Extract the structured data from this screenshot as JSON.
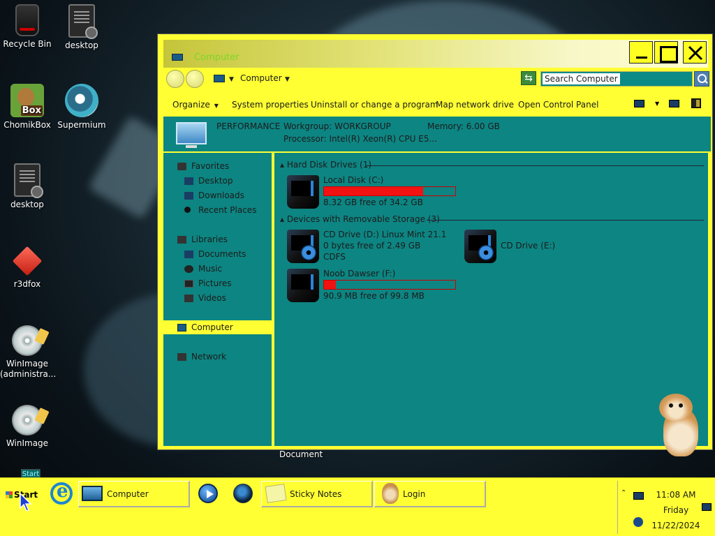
{
  "desktop": {
    "icons": [
      {
        "label": "Recycle Bin",
        "icon": "recycle-bin-icon"
      },
      {
        "label": "desktop",
        "icon": "document-icon"
      },
      {
        "label": "ChomikBox",
        "icon": "chomikbox-icon"
      },
      {
        "label": "Supermium",
        "icon": "supermium-icon"
      },
      {
        "label": "desktop",
        "icon": "document-icon"
      },
      {
        "label": "r3dfox",
        "icon": "r3dfox-icon"
      },
      {
        "label": "WinImage\n(administra...",
        "icon": "winimage-icon"
      },
      {
        "label": "WinImage",
        "icon": "winimage-icon"
      }
    ],
    "chomik_badge": "Box",
    "document_label": "Document",
    "start_tooltip": "Start"
  },
  "window": {
    "title": "Computer",
    "address": {
      "location": "Computer",
      "search_placeholder": "Search Computer"
    },
    "toolbar": {
      "organize": "Organize",
      "system_properties": "System properties",
      "uninstall": "Uninstall or change a program",
      "map_drive": "Map network drive",
      "control_panel": "Open Control Panel"
    },
    "details": {
      "name": "PERFORMANCE",
      "workgroup": "Workgroup: WORKGROUP",
      "memory": "Memory: 6.00 GB",
      "processor": "Processor: Intel(R) Xeon(R) CPU E5..."
    },
    "nav": {
      "favorites": "Favorites",
      "desktop": "Desktop",
      "downloads": "Downloads",
      "recent": "Recent Places",
      "libraries": "Libraries",
      "documents": "Documents",
      "music": "Music",
      "pictures": "Pictures",
      "videos": "Videos",
      "computer": "Computer",
      "network": "Network"
    },
    "groups": {
      "hdd": "Hard Disk Drives (1)",
      "removable": "Devices with Removable Storage (3)"
    },
    "drives": {
      "c": {
        "name": "Local Disk (C:)",
        "free": "8.32 GB free of 34.2 GB",
        "used_fraction": 0.757
      },
      "d": {
        "name": "CD Drive (D:) Linux Mint 21.1",
        "free": "0 bytes free of 2.49 GB",
        "fs": "CDFS"
      },
      "e": {
        "name": "CD Drive (E:)"
      },
      "f": {
        "name": "Noob Dawser (F:)",
        "free": "90.9 MB free of 99.8 MB",
        "used_fraction": 0.089
      }
    }
  },
  "taskbar": {
    "start": "Start",
    "computer": "Computer",
    "sticky_notes": "Sticky Notes",
    "login": "Login",
    "time": "11:08 AM",
    "day": "Friday",
    "date": "11/22/2024"
  },
  "colors": {
    "theme_yellow": "#ffff33",
    "pane_teal": "#0d8582",
    "usage_red": "#f21212"
  }
}
